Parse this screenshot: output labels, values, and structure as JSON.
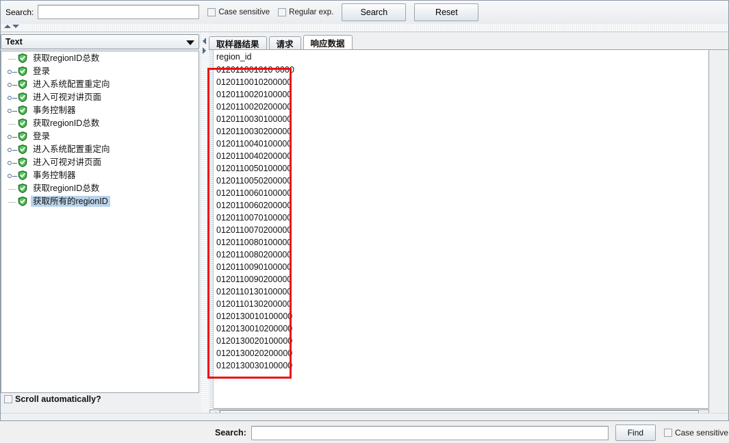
{
  "toolbar": {
    "search_label": "Search:",
    "search_value": "",
    "search_placeholder": "",
    "case_sensitive_label": "Case sensitive",
    "regular_exp_label": "Regular exp.",
    "search_button": "Search",
    "reset_button": "Reset"
  },
  "left_panel": {
    "combo_value": "Text",
    "scroll_automatically_label": "Scroll automatically?",
    "tree": [
      {
        "label": "获取regionID总数",
        "toggle": false,
        "selected": false
      },
      {
        "label": "登录",
        "toggle": true,
        "selected": false
      },
      {
        "label": "进入系统配置重定向",
        "toggle": true,
        "selected": false
      },
      {
        "label": "进入可视对讲页面",
        "toggle": true,
        "selected": false
      },
      {
        "label": "事务控制器",
        "toggle": true,
        "selected": false
      },
      {
        "label": "获取regionID总数",
        "toggle": false,
        "selected": false
      },
      {
        "label": "登录",
        "toggle": true,
        "selected": false
      },
      {
        "label": "进入系统配置重定向",
        "toggle": true,
        "selected": false
      },
      {
        "label": "进入可视对讲页面",
        "toggle": true,
        "selected": false
      },
      {
        "label": "事务控制器",
        "toggle": true,
        "selected": false
      },
      {
        "label": "获取regionID总数",
        "toggle": false,
        "selected": false
      },
      {
        "label": "获取所有的regionID",
        "toggle": false,
        "selected": true
      }
    ]
  },
  "right_panel": {
    "tabs": [
      {
        "label": "取样器结果",
        "active": false
      },
      {
        "label": "请求",
        "active": false
      },
      {
        "label": "响应数据",
        "active": true
      }
    ],
    "data_header": "region_id",
    "data_rows": [
      "012011001010 0000",
      "0120110010200000",
      "0120110020100000",
      "0120110020200000",
      "0120110030100000",
      "0120110030200000",
      "0120110040100000",
      "0120110040200000",
      "0120110050100000",
      "0120110050200000",
      "0120110060100000",
      "0120110060200000",
      "0120110070100000",
      "0120110070200000",
      "0120110080100000",
      "0120110080200000",
      "0120110090100000",
      "0120110090200000",
      "0120110130100000",
      "0120110130200000",
      "0120130010100000",
      "0120130010200000",
      "0120130020100000",
      "0120130020200000",
      "0120130030100000"
    ],
    "bottom_search": {
      "label": "Search:",
      "value": "",
      "find_button": "Find",
      "case_sensitive_label": "Case sensitive"
    }
  },
  "colors": {
    "annotation_red": "#ee1111",
    "selection_blue": "#b9d3ea",
    "status_green": "#22a02a"
  }
}
